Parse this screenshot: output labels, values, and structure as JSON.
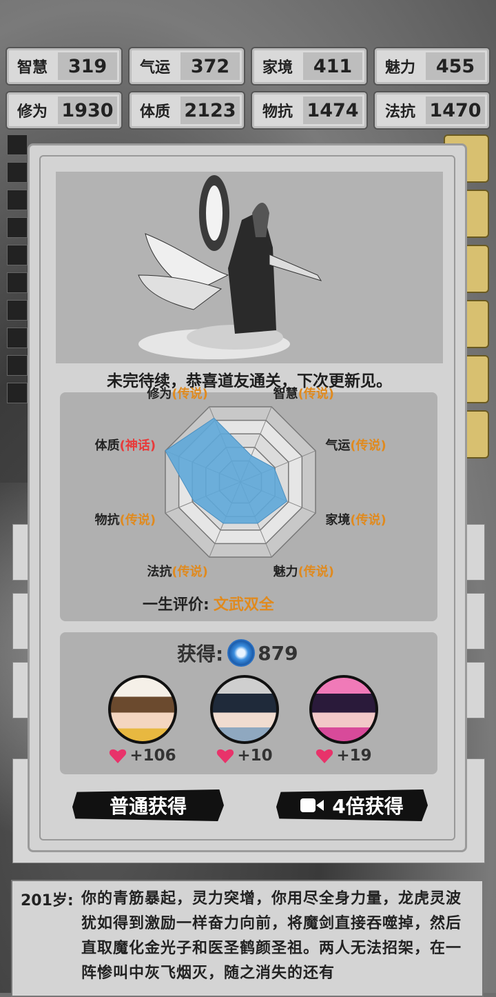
{
  "stats": [
    {
      "label": "智慧",
      "value": "319"
    },
    {
      "label": "气运",
      "value": "372"
    },
    {
      "label": "家境",
      "value": "411"
    },
    {
      "label": "魅力",
      "value": "455"
    },
    {
      "label": "修为",
      "value": "1930"
    },
    {
      "label": "体质",
      "value": "2123"
    },
    {
      "label": "物抗",
      "value": "1474"
    },
    {
      "label": "法抗",
      "value": "1470"
    }
  ],
  "modal": {
    "banner": "未完待续，恭喜道友通关，下次更新见。",
    "radar": {
      "attributes": [
        {
          "name": "修为",
          "quality": "传说",
          "level": 0.85
        },
        {
          "name": "智慧",
          "quality": "传说",
          "level": 0.35
        },
        {
          "name": "气运",
          "quality": "传说",
          "level": 0.45
        },
        {
          "name": "家境",
          "quality": "传说",
          "level": 0.62
        },
        {
          "name": "魅力",
          "quality": "传说",
          "level": 0.55
        },
        {
          "name": "法抗",
          "quality": "传说",
          "level": 0.55
        },
        {
          "name": "物抗",
          "quality": "传说",
          "level": 0.62
        },
        {
          "name": "体质",
          "quality": "神话",
          "level": 1.0
        }
      ],
      "eval_label": "一生评价:",
      "eval_value": "文武双全"
    },
    "reward": {
      "label": "获得:",
      "amount": "879",
      "characters": [
        {
          "gain": "+106"
        },
        {
          "gain": "+10"
        },
        {
          "gain": "+19"
        }
      ]
    },
    "buttons": {
      "normal": "普通获得",
      "quad": "4倍获得"
    }
  },
  "log": {
    "age": "201岁:",
    "text": "你的青筋暴起，灵力突增，你用尽全身力量，龙虎灵波犹如得到激励一样奋力向前，将魔剑直接吞噬掉，然后直取魔化金光子和医圣鹤颜圣祖。两人无法招架，在一阵惨叫中灰飞烟灭，随之消失的还有"
  },
  "colors": {
    "accent": "#e08a1e",
    "myth": "#e83a3a",
    "radar_fill": "#5ea7d8",
    "heart": "#e8336a"
  }
}
